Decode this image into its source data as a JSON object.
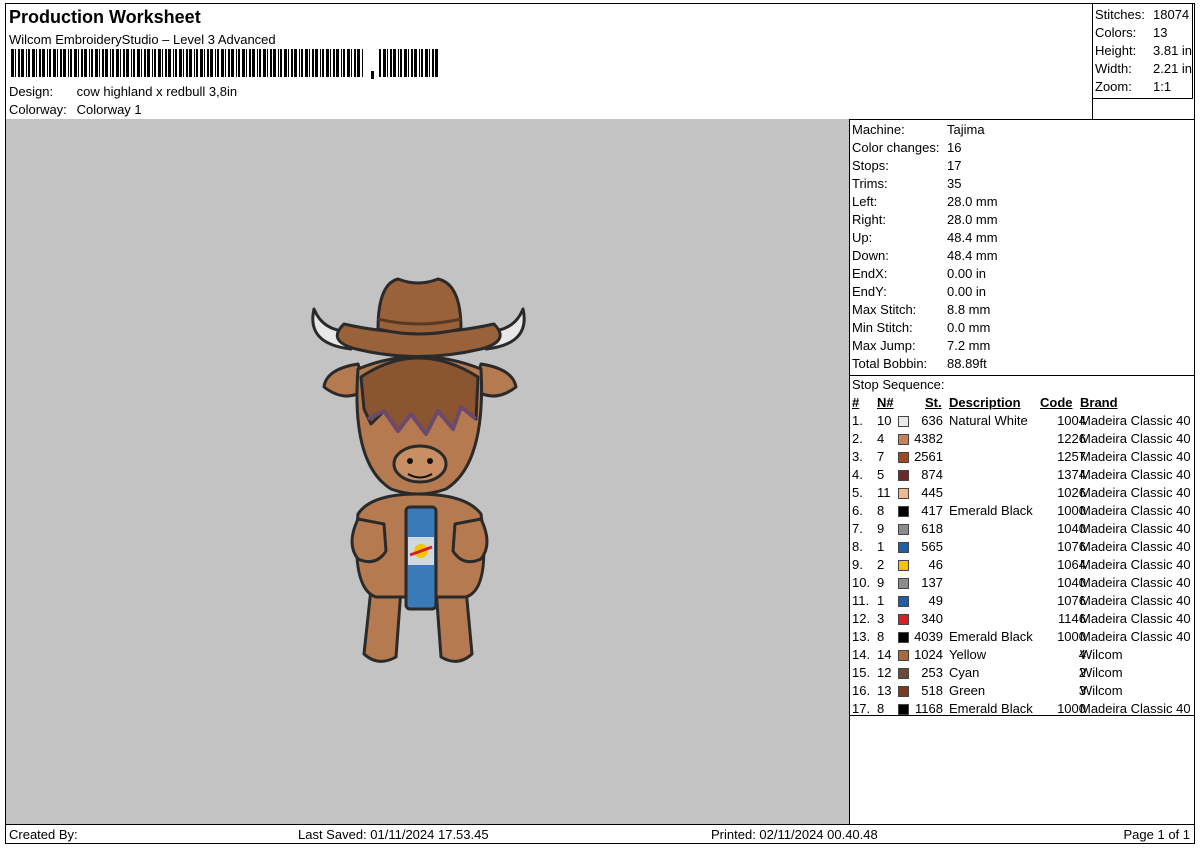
{
  "header": {
    "title": "Production Worksheet",
    "subtitle": "Wilcom EmbroideryStudio – Level 3 Advanced",
    "design_label": "Design:",
    "design_value": "cow highland x redbull 3,8in",
    "colorway_label": "Colorway:",
    "colorway_value": "Colorway 1"
  },
  "summary": [
    {
      "label": "Stitches:",
      "value": "18074"
    },
    {
      "label": "Colors:",
      "value": "13"
    },
    {
      "label": "Height:",
      "value": "3.81 in"
    },
    {
      "label": "Width:",
      "value": "2.21 in"
    },
    {
      "label": "Zoom:",
      "value": "1:1"
    }
  ],
  "machine_info": [
    {
      "label": "Machine:",
      "value": "Tajima"
    },
    {
      "label": "Color changes:",
      "value": "16"
    },
    {
      "label": "Stops:",
      "value": "17"
    },
    {
      "label": "Trims:",
      "value": "35"
    },
    {
      "label": "Left:",
      "value": "28.0 mm"
    },
    {
      "label": "Right:",
      "value": "28.0 mm"
    },
    {
      "label": "Up:",
      "value": "48.4 mm"
    },
    {
      "label": "Down:",
      "value": "48.4 mm"
    },
    {
      "label": "EndX:",
      "value": "0.00 in"
    },
    {
      "label": "EndY:",
      "value": "0.00 in"
    },
    {
      "label": "Max Stitch:",
      "value": "8.8 mm"
    },
    {
      "label": "Min Stitch:",
      "value": "0.0 mm"
    },
    {
      "label": "Max Jump:",
      "value": "7.2 mm"
    },
    {
      "label": "Total Bobbin:",
      "value": "88.89ft"
    }
  ],
  "stop_sequence": {
    "caption": "Stop Sequence:",
    "headers": {
      "num": "#",
      "n": "N#",
      "st": "St.",
      "description": "Description",
      "code": "Code",
      "brand": "Brand"
    },
    "rows": [
      {
        "num": "1.",
        "n": "10",
        "color": "#ebebeb",
        "st": "636",
        "description": "Natural White",
        "code": "1004",
        "brand": "Madeira Classic 40"
      },
      {
        "num": "2.",
        "n": "4",
        "color": "#c8825a",
        "st": "4382",
        "description": "",
        "code": "1226",
        "brand": "Madeira Classic 40"
      },
      {
        "num": "3.",
        "n": "7",
        "color": "#9a4a22",
        "st": "2561",
        "description": "",
        "code": "1257",
        "brand": "Madeira Classic 40"
      },
      {
        "num": "4.",
        "n": "5",
        "color": "#6b2a2a",
        "st": "874",
        "description": "",
        "code": "1374",
        "brand": "Madeira Classic 40"
      },
      {
        "num": "5.",
        "n": "11",
        "color": "#f0b890",
        "st": "445",
        "description": "",
        "code": "1026",
        "brand": "Madeira Classic 40"
      },
      {
        "num": "6.",
        "n": "8",
        "color": "#000000",
        "st": "417",
        "description": "Emerald Black",
        "code": "1000",
        "brand": "Madeira Classic 40"
      },
      {
        "num": "7.",
        "n": "9",
        "color": "#8c8c8c",
        "st": "618",
        "description": "",
        "code": "1040",
        "brand": "Madeira Classic 40"
      },
      {
        "num": "8.",
        "n": "1",
        "color": "#1e5fa8",
        "st": "565",
        "description": "",
        "code": "1076",
        "brand": "Madeira Classic 40"
      },
      {
        "num": "9.",
        "n": "2",
        "color": "#f5c400",
        "st": "46",
        "description": "",
        "code": "1064",
        "brand": "Madeira Classic 40"
      },
      {
        "num": "10.",
        "n": "9",
        "color": "#8c8c8c",
        "st": "137",
        "description": "",
        "code": "1040",
        "brand": "Madeira Classic 40"
      },
      {
        "num": "11.",
        "n": "1",
        "color": "#1e5fa8",
        "st": "49",
        "description": "",
        "code": "1076",
        "brand": "Madeira Classic 40"
      },
      {
        "num": "12.",
        "n": "3",
        "color": "#d42020",
        "st": "340",
        "description": "",
        "code": "1146",
        "brand": "Madeira Classic 40"
      },
      {
        "num": "13.",
        "n": "8",
        "color": "#000000",
        "st": "4039",
        "description": "Emerald Black",
        "code": "1000",
        "brand": "Madeira Classic 40"
      },
      {
        "num": "14.",
        "n": "14",
        "color": "#a86a3a",
        "st": "1024",
        "description": "Yellow",
        "code": "4",
        "brand": "Wilcom"
      },
      {
        "num": "15.",
        "n": "12",
        "color": "#6b4a3a",
        "st": "253",
        "description": "Cyan",
        "code": "2",
        "brand": "Wilcom"
      },
      {
        "num": "16.",
        "n": "13",
        "color": "#7a3a22",
        "st": "518",
        "description": "Green",
        "code": "3",
        "brand": "Wilcom"
      },
      {
        "num": "17.",
        "n": "8",
        "color": "#000000",
        "st": "1168",
        "description": "Emerald Black",
        "code": "1000",
        "brand": "Madeira Classic 40"
      }
    ]
  },
  "footer": {
    "created_by": "Created By:",
    "last_saved": "Last Saved: 01/11/2024 17.53.45",
    "printed": "Printed: 02/11/2024 00.40.48",
    "page": "Page 1 of 1"
  },
  "preview": {
    "background": "#c3c3c3"
  }
}
